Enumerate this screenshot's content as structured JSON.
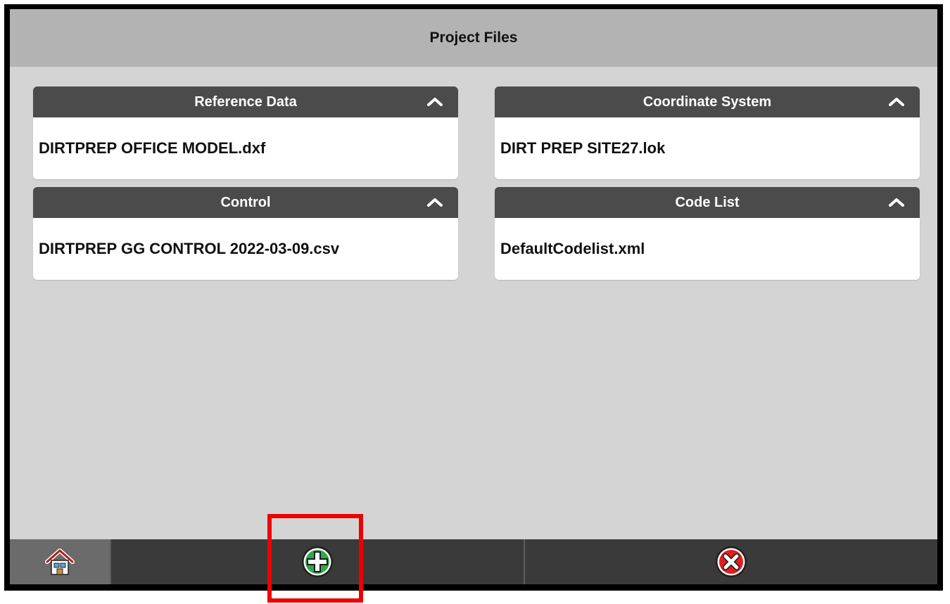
{
  "header": {
    "title": "Project Files"
  },
  "panels": [
    {
      "title": "Reference Data",
      "file": "DIRTPREP OFFICE MODEL.dxf"
    },
    {
      "title": "Coordinate System",
      "file": "DIRT PREP SITE27.lok"
    },
    {
      "title": "Control",
      "file": "DIRTPREP GG CONTROL 2022-03-09.csv"
    },
    {
      "title": "Code List",
      "file": "DefaultCodelist.xml"
    }
  ],
  "toolbar": {
    "home_icon": "home-icon",
    "add_icon": "add-plus-icon",
    "cancel_icon": "close-x-icon"
  },
  "colors": {
    "title_bar": "#b3b3b3",
    "panel_header": "#4b4b4b",
    "background": "#d4d4d4",
    "bottom_bar": "#3a3a3a",
    "add_green": "#2fa84a",
    "cancel_red": "#e01f1f",
    "highlight": "#ee0000"
  }
}
